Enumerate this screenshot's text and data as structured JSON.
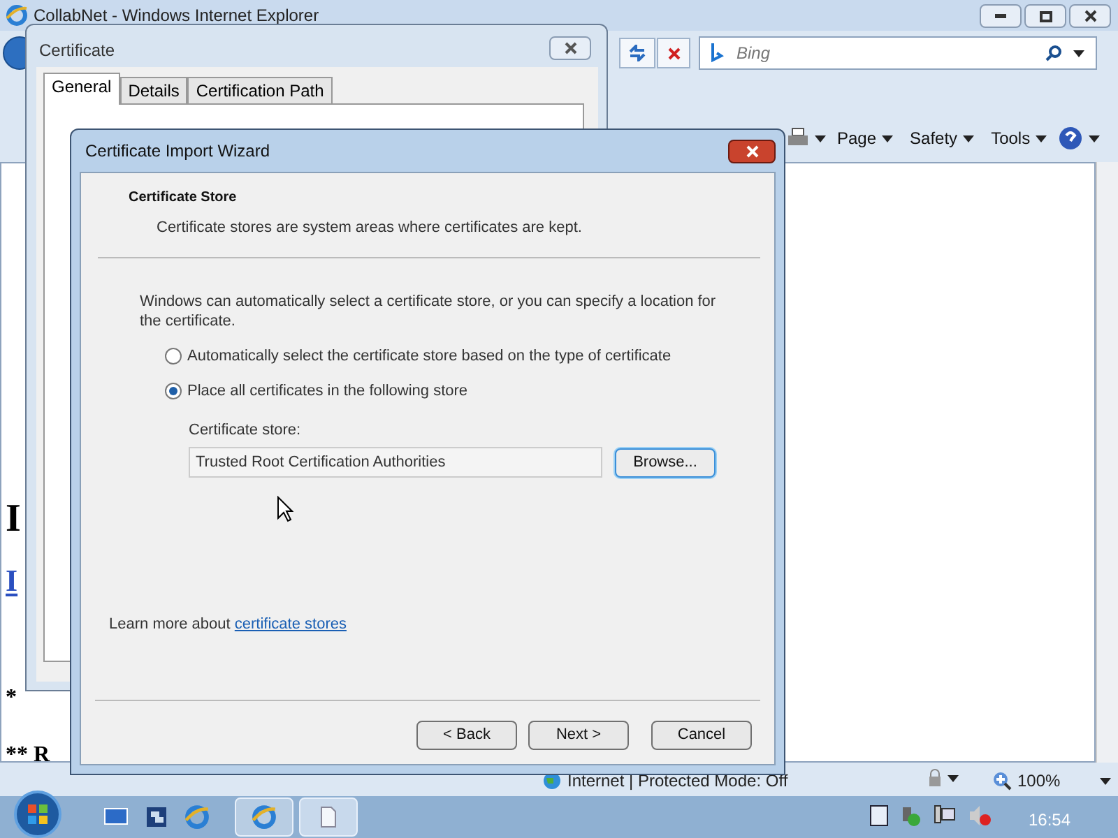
{
  "browser": {
    "title": "CollabNet - Windows Internet Explorer",
    "search": {
      "placeholder": "Bing"
    },
    "command_menus": [
      {
        "label": "Page"
      },
      {
        "label": "Safety"
      },
      {
        "label": "Tools"
      }
    ],
    "page_fragments": [
      {
        "kind": "heading",
        "text": "I"
      },
      {
        "kind": "link",
        "text": "I"
      },
      {
        "kind": "text",
        "text": "*"
      },
      {
        "kind": "text",
        "text": "** R"
      }
    ],
    "status": {
      "zone": "Internet | Protected Mode: Off",
      "zoom": "100%"
    }
  },
  "certificate_dialog": {
    "title": "Certificate",
    "tabs": [
      {
        "label": "General",
        "selected": true
      },
      {
        "label": "Details",
        "selected": false
      },
      {
        "label": "Certification Path",
        "selected": false
      }
    ]
  },
  "wizard": {
    "title": "Certificate Import Wizard",
    "heading": "Certificate Store",
    "subheading": "Certificate stores are system areas where certificates are kept.",
    "intro": "Windows can automatically select a certificate store, or you can specify a location for the certificate.",
    "options": [
      {
        "label": "Automatically select the certificate store based on the type of certificate",
        "selected": false
      },
      {
        "label": "Place all certificates in the following store",
        "selected": true
      }
    ],
    "store_label": "Certificate store:",
    "store_value": "Trusted Root Certification Authorities",
    "browse": {
      "label": "Browse...",
      "focused": true
    },
    "learn_more": {
      "text": "Learn more about",
      "link": "certificate stores"
    },
    "buttons": [
      {
        "label": "< Back"
      },
      {
        "label": "Next >"
      },
      {
        "label": "Cancel"
      }
    ]
  },
  "taskbar": {
    "clock": "16:54"
  }
}
